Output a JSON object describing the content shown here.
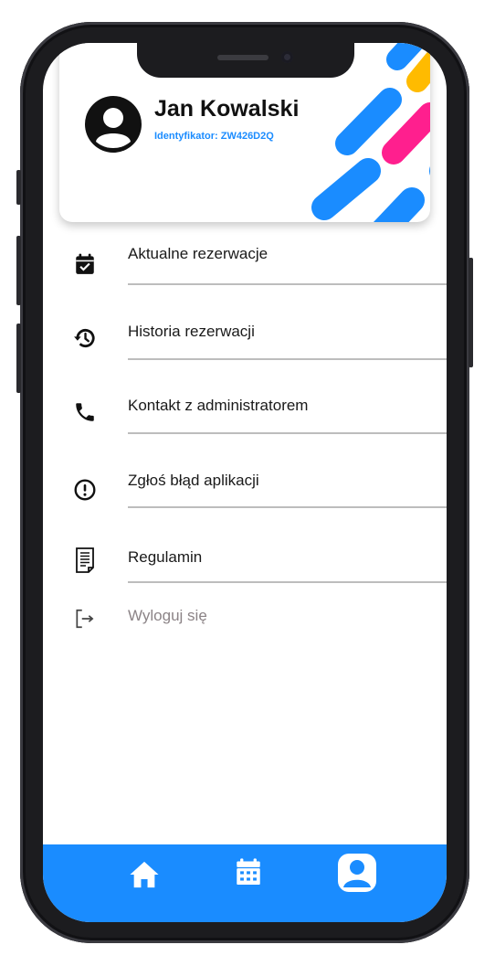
{
  "profile": {
    "name": "Jan Kowalski",
    "identifier": "Identyfikator: ZW426D2Q"
  },
  "menu": {
    "items": [
      {
        "label": "Aktualne rezerwacje",
        "icon": "calendar-check-icon"
      },
      {
        "label": "Historia rezerwacji",
        "icon": "history-icon"
      },
      {
        "label": "Kontakt z administratorem",
        "icon": "phone-icon"
      },
      {
        "label": "Zgłoś błąd aplikacji",
        "icon": "alert-circle-icon"
      },
      {
        "label": "Regulamin",
        "icon": "document-icon"
      }
    ],
    "logout": {
      "label": "Wyloguj się",
      "icon": "logout-icon"
    }
  },
  "bottom_nav": {
    "items": [
      {
        "name": "home",
        "icon": "home-icon"
      },
      {
        "name": "calendar",
        "icon": "calendar-icon"
      },
      {
        "name": "profile",
        "icon": "user-icon",
        "active": true
      }
    ]
  },
  "colors": {
    "accent": "#1a8cff",
    "deco_blue": "#1a8cff",
    "deco_pink": "#ff1f8e",
    "deco_yellow": "#ffbb00",
    "logout_text": "#8c8487"
  }
}
